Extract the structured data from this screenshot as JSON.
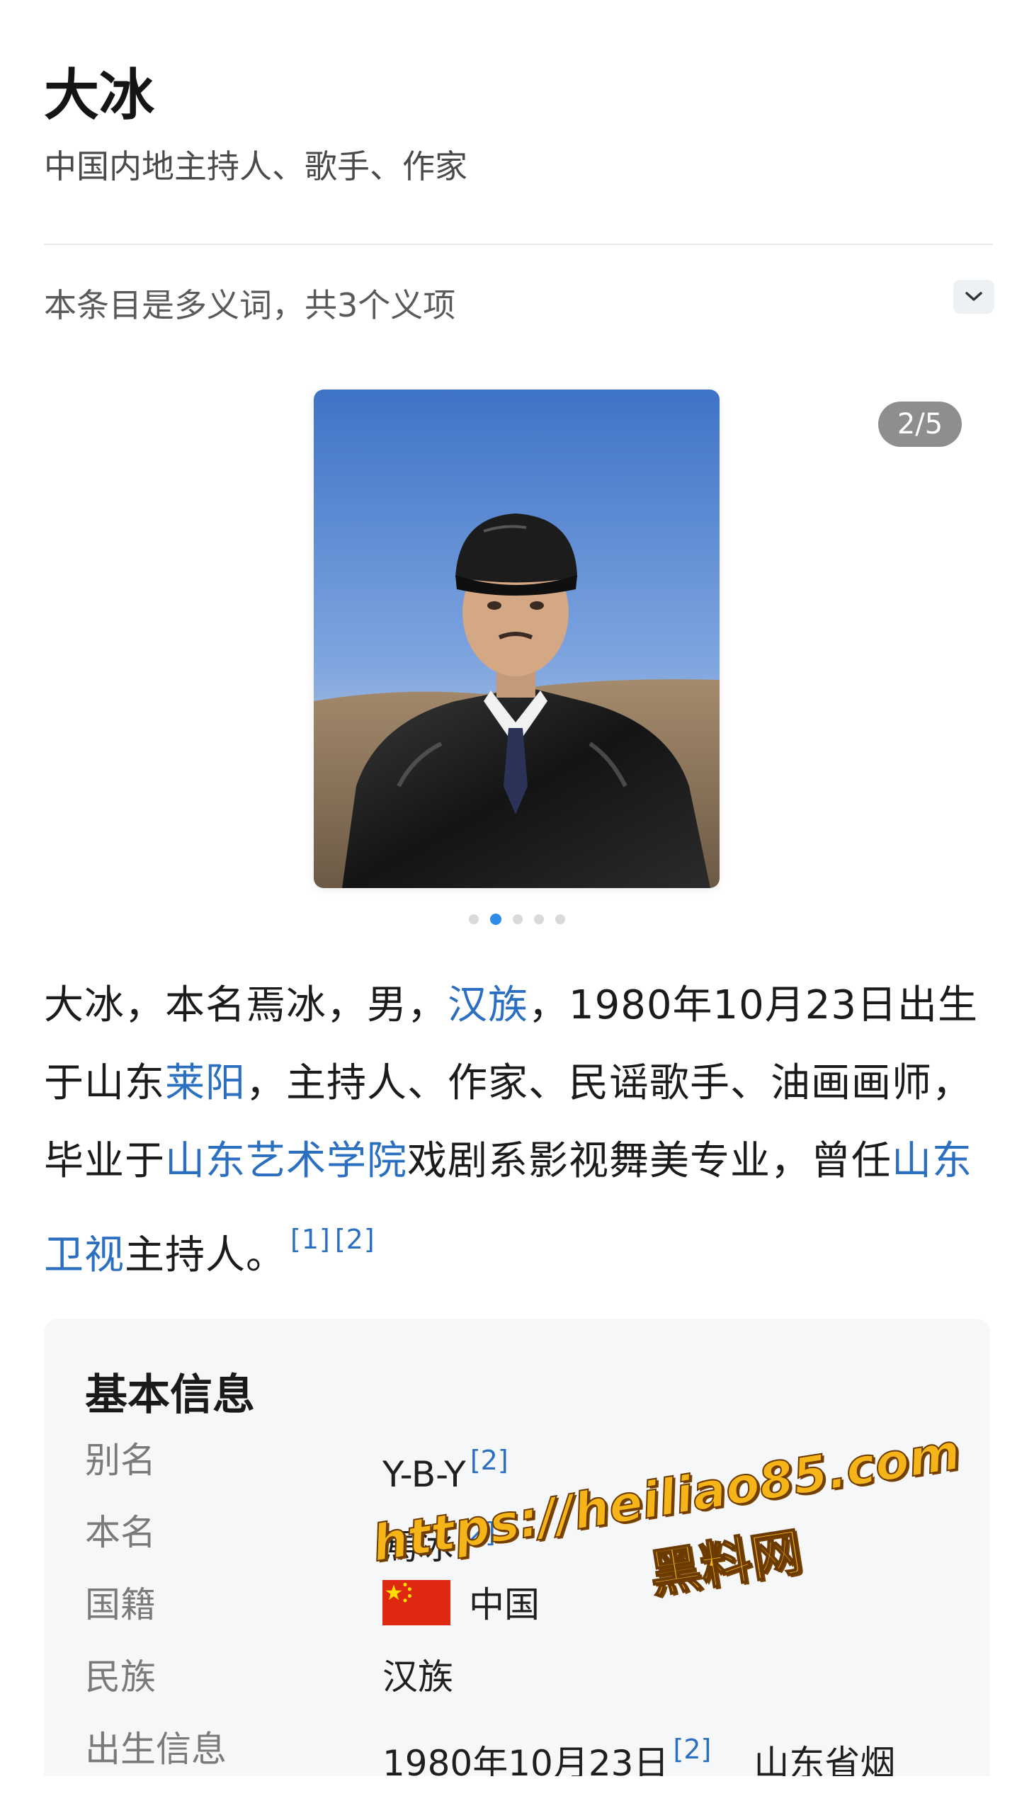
{
  "header": {
    "title": "大冰",
    "subtitle": "中国内地主持人、歌手、作家"
  },
  "polysemy": {
    "text": "本条目是多义词，共3个义项",
    "toggle_icon": "chevron-down-icon"
  },
  "gallery": {
    "counter": "2/5",
    "current_index": 2,
    "total": 5
  },
  "summary": {
    "p1": "大冰，本名焉冰，男，",
    "link_ethnicity": "汉族",
    "p2": "，1980年10月23日出生于山东",
    "link_hometown": "莱阳",
    "p3": "，主持人、作家、民谣歌手、油画画师，毕业于",
    "link_school": "山东艺术学院",
    "p4": "戏剧系影视舞美专业，曾任",
    "link_station": "山东卫视",
    "p5": "主持人。",
    "ref1": "[1]",
    "ref2": "[2]"
  },
  "basic_info": {
    "title": "基本信息",
    "rows": [
      {
        "label": "别名",
        "value": "Y-B-Y",
        "ref": "[2]"
      },
      {
        "label": "本名",
        "value": "焉冰",
        "ref": "[2]"
      },
      {
        "label": "国籍",
        "value": "中国",
        "ref": ""
      },
      {
        "label": "民族",
        "value": "汉族",
        "ref": ""
      },
      {
        "label": "出生信息",
        "value": "1980年10月23日",
        "ref": "[2]",
        "extra": "山东省烟"
      }
    ]
  },
  "watermark": {
    "url": "https://heiliao85.com",
    "name": "黑料网"
  },
  "colors": {
    "link": "#2b6fc0",
    "active_dot": "#2d8bea",
    "badge_bg": "#8e8e8e",
    "card_bg": "#f6f7f9",
    "watermark": "#f5b417"
  }
}
